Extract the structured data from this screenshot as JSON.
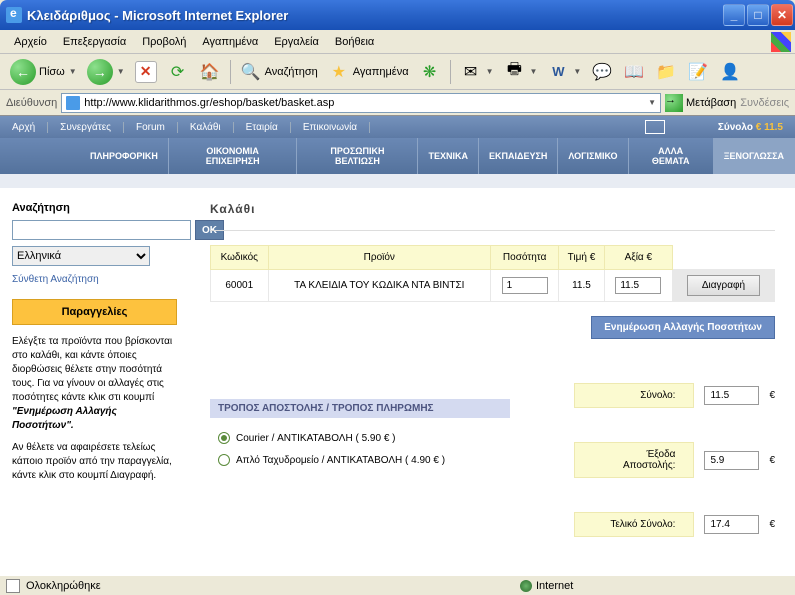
{
  "window": {
    "title": "Κλειδάριθμος - Microsoft Internet Explorer"
  },
  "menubar": [
    "Αρχείο",
    "Επεξεργασία",
    "Προβολή",
    "Αγαπημένα",
    "Εργαλεία",
    "Βοήθεια"
  ],
  "toolbar": {
    "back": "Πίσω",
    "search": "Αναζήτηση",
    "favorites": "Αγαπημένα"
  },
  "address": {
    "label": "Διεύθυνση",
    "url": "http://www.klidarithmos.gr/eshop/basket/basket.asp",
    "go": "Μετάβαση",
    "links": "Συνδέσεις"
  },
  "sitenav": {
    "items": [
      "Αρχή",
      "Συνεργάτες",
      "Forum",
      "Καλάθι",
      "Εταιρία",
      "Επικοινωνία"
    ],
    "total_label": "Σύνολο",
    "total_value": "€ 11.5"
  },
  "categories": [
    "ΠΛΗΡΟΦΟΡΙΚΗ",
    "ΟΙΚΟΝΟΜΙΑ ΕΠΙΧΕΙΡΗΣΗ",
    "ΠΡΟΣΩΠΙΚΗ ΒΕΛΤΙΩΣΗ",
    "ΤΕΧΝΙΚΑ",
    "ΕΚΠΑΙΔΕΥΣΗ",
    "ΛΟΓΙΣΜΙΚΟ",
    "ΑΛΛΑ ΘΕΜΑΤΑ",
    "ΞΕΝΟΓΛΩΣΣΑ"
  ],
  "sidebar": {
    "search_title": "Αναζήτηση",
    "ok": "OK",
    "lang": "Ελληνικά",
    "adv": "Σύνθετη Αναζήτηση",
    "orders": "Παραγγελίες",
    "p1a": "Ελέγξτε τα προϊόντα που βρίσκονται στο καλάθι, και κάντε όποιες διορθώσεις θέλετε στην ποσότητά τους. Για να γίνουν οι αλλαγές στις ποσότητες κάντε κλικ στι κουμπί ",
    "p1b": "\"Ενημέρωση Αλλαγής Ποσοτήτων\".",
    "p2": "Αν θέλετε να αφαιρέσετε τελείως κάποιο προϊόν από την παραγγελία, κάντε κλικ στο κουμπί Διαγραφή."
  },
  "basket": {
    "title": "Καλάθι",
    "headers": {
      "code": "Κωδικός",
      "product": "Προϊόν",
      "qty": "Ποσότητα",
      "price": "Τιμή €",
      "value": "Αξία €"
    },
    "row": {
      "code": "60001",
      "product": "ΤΑ ΚΛΕΙΔΙΑ ΤΟΥ ΚΩΔΙΚΑ ΝΤΑ ΒΙΝΤΣΙ",
      "qty": "1",
      "price": "11.5",
      "value": "11.5"
    },
    "delete": "Διαγραφή",
    "update": "Ενημέρωση  Αλλαγής Ποσοτήτων"
  },
  "shipping": {
    "header": "ΤΡΟΠΟΣ ΑΠΟΣΤΟΛΗΣ / ΤΡΟΠΟΣ ΠΛΗΡΩΜΗΣ",
    "opt1": "Courier / ΑΝΤΙΚΑΤΑΒΟΛΗ ( 5.90 € )",
    "opt2": "Απλό Ταχυδρομείο / ΑΝΤΙΚΑΤΑΒΟΛΗ ( 4.90 € )"
  },
  "totals": {
    "subtotal_label": "Σύνολο:",
    "subtotal": "11.5",
    "ship_label": "Έξοδα Αποστολής:",
    "ship": "5.9",
    "final_label": "Τελικό Σύνολο:",
    "final": "17.4",
    "euro": "€"
  },
  "status": {
    "done": "Ολοκληρώθηκε",
    "zone": "Internet"
  }
}
